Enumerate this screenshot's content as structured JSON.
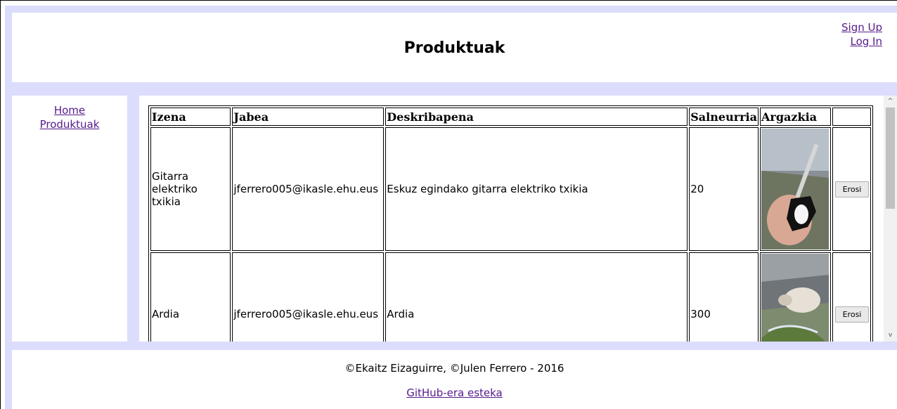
{
  "header": {
    "title": "Produktuak",
    "sign_up": "Sign Up",
    "log_in": "Log In"
  },
  "nav": {
    "home": "Home",
    "products": "Produktuak"
  },
  "table": {
    "headers": [
      "Izena",
      "Jabea",
      "Deskribapena",
      "Salneurria",
      "Argazkia",
      ""
    ],
    "rows": [
      {
        "name": "Gitarra elektriko txikia",
        "owner": "jferrero005@ikasle.ehu.eus",
        "description": "Eskuz egindako gitarra elektriko txikia",
        "price": "20",
        "image": "guitar-photo",
        "buy": "Erosi"
      },
      {
        "name": "Ardia",
        "owner": "jferrero005@ikasle.ehu.eus",
        "description": "Ardia",
        "price": "300",
        "image": "sheep-photo",
        "buy": "Erosi"
      }
    ]
  },
  "footer": {
    "copyright": "©Ekaitz Eizaguirre, ©Julen Ferrero - 2016",
    "github_link": "GitHub-era esteka"
  },
  "colors": {
    "frame": "#dcdcfc",
    "link": "#551a8b"
  }
}
